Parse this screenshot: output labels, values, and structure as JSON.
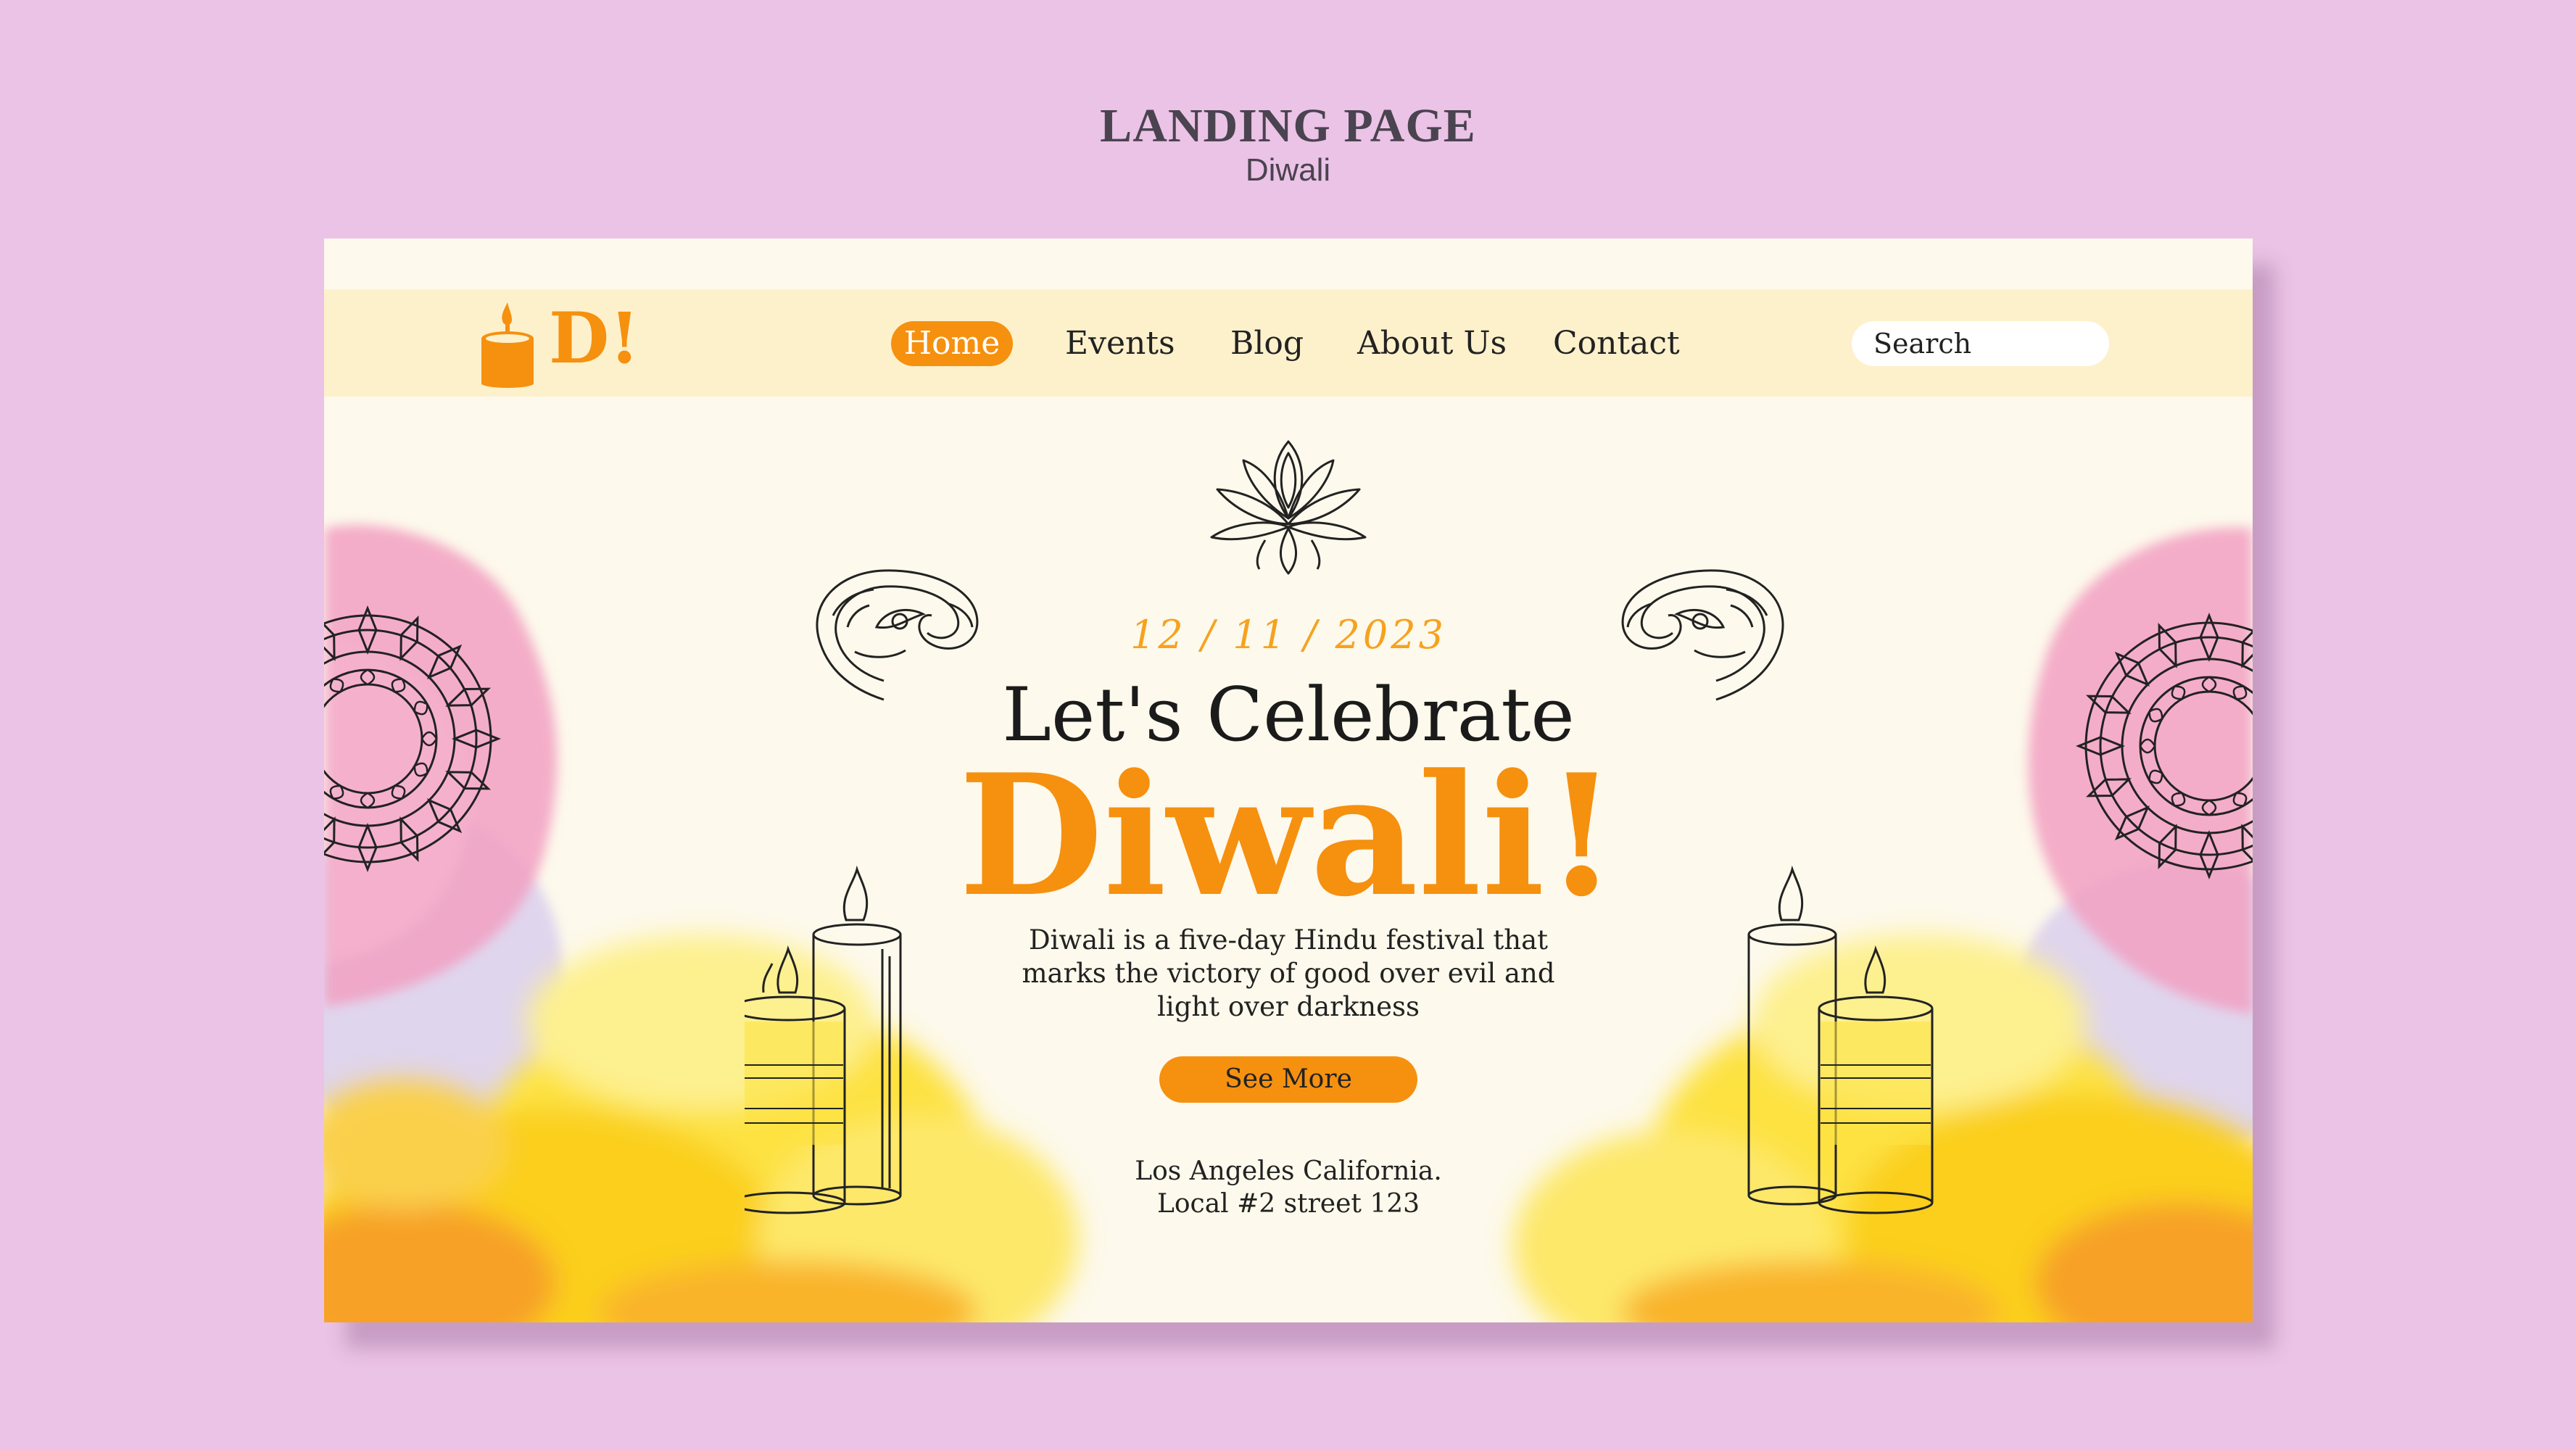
{
  "showcase": {
    "title": "LANDING PAGE",
    "subtitle": "Diwali"
  },
  "nav": {
    "logo": "D!",
    "items": [
      {
        "label": "Home"
      },
      {
        "label": "Events"
      },
      {
        "label": "Blog"
      },
      {
        "label": "About Us"
      },
      {
        "label": "Contact"
      }
    ],
    "search_placeholder": "Search"
  },
  "hero": {
    "date": "12 / 11 / 2023",
    "heading": "Let's Celebrate",
    "title": "Diwali!",
    "description": "Diwali is a five-day Hindu festival that marks the victory of good over evil and light over darkness",
    "cta_label": "See More",
    "address_line1": "Los Angeles California.",
    "address_line2": "Local #2 street 123"
  },
  "colors": {
    "page_background": "#ebc3e6",
    "card_background": "#fdf9ec",
    "nav_background": "#fdf1cc",
    "accent": "#f6900f",
    "date_color": "#f6a21f",
    "watercolor_pink": "#f2a0c2",
    "watercolor_yellow": "#fdd520",
    "watercolor_orange": "#f9a61e"
  },
  "icons": [
    "candle-logo-icon",
    "lotus-icon",
    "paisley-icon",
    "mandala-icon",
    "candle-icon"
  ]
}
